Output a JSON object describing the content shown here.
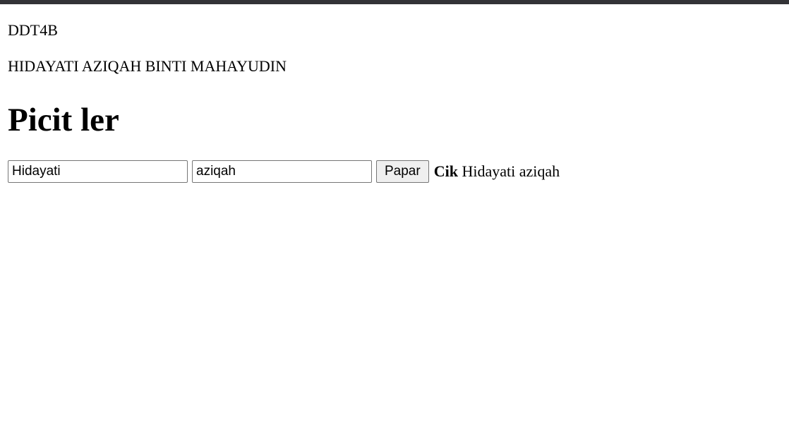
{
  "header": {
    "class_code": "DDT4B",
    "student_name": "HIDAYATI AZIQAH BINTI MAHAYUDIN"
  },
  "main": {
    "heading": "Picit ler",
    "first_name_input": {
      "value": "Hidayati",
      "placeholder": ""
    },
    "last_name_input": {
      "value": "aziqah",
      "placeholder": ""
    },
    "show_button_label": "Papar",
    "result": {
      "title": "Cik",
      "name": "Hidayati aziqah"
    }
  },
  "colors": {
    "top_bar": "#333337",
    "background": "#ffffff",
    "text": "#000000",
    "button_background": "#efefef",
    "field_border": "#767676"
  }
}
